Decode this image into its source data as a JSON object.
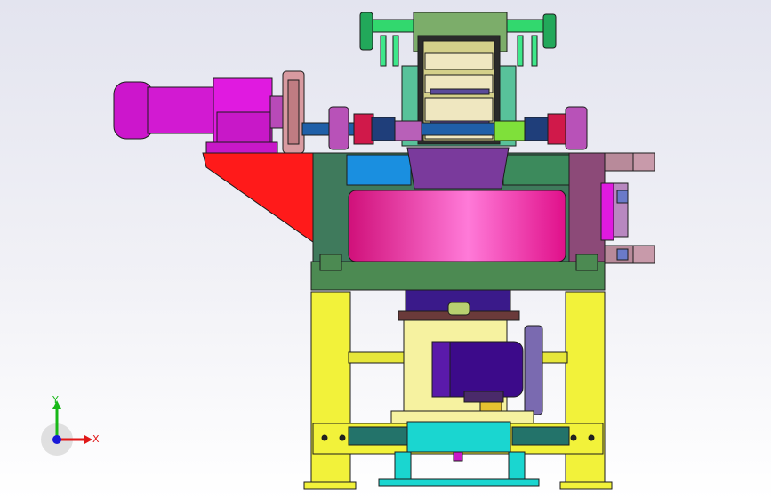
{
  "viewport": {
    "background_top": "#e3e4ef",
    "background_bottom": "#ffffff"
  },
  "model": {
    "colors": {
      "frame_yellow": "#f2f23a",
      "base_green": "#4c8a52",
      "housing_green": "#3f7a5c",
      "hopper_red": "#ff1a1a",
      "drum_magenta": "#ff2a9a",
      "motor_magenta": "#d21ad2",
      "motor_purple": "#3c0a8a",
      "cyan_bracket": "#1ad6d0",
      "teal_bar": "#23736a",
      "mint_green": "#32e07a",
      "shaft_blue": "#1f5fa8",
      "outline": "#1c1c1c"
    }
  },
  "triad": {
    "x_label": "X",
    "y_label": "Y",
    "x_color": "#e01818",
    "y_color": "#18b818",
    "z_color": "#1818d8"
  }
}
